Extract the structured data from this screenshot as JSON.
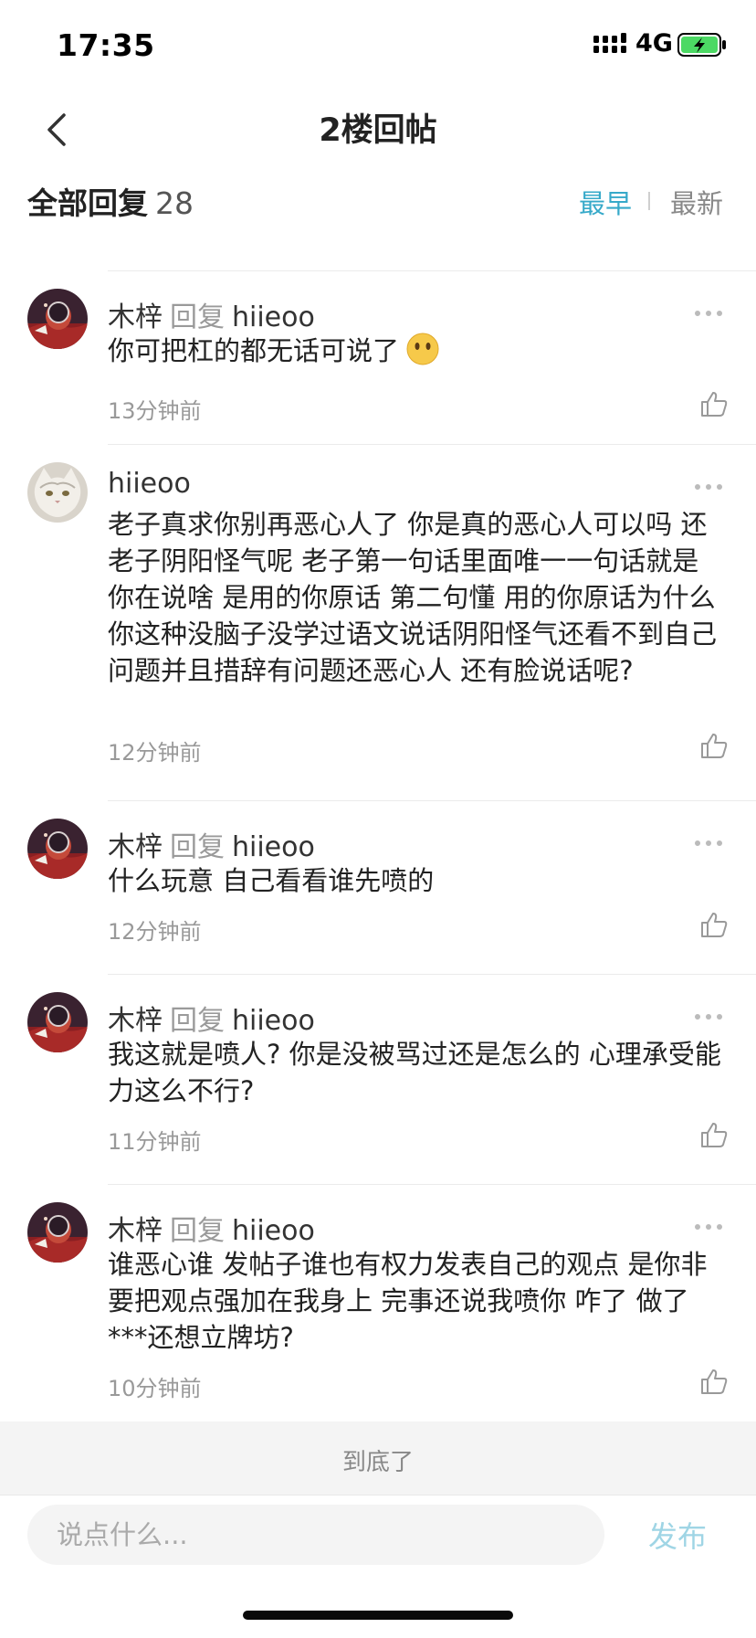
{
  "status_bar": {
    "time": "17:35",
    "network": "4G"
  },
  "nav": {
    "title": "2楼回帖"
  },
  "header": {
    "title": "全部回复",
    "count": "28",
    "sort_earliest": "最早",
    "sort_latest": "最新"
  },
  "reply_word": "回复",
  "replies": [
    {
      "author": "木梓",
      "target": "hiieoo",
      "text": "你可把杠的都无话可说了",
      "emoji": "no-mouth-emoji",
      "time": "13分钟前",
      "avatar": "astronaut-avatar"
    },
    {
      "author": "hiieoo",
      "target": "",
      "text": "老子真求你别再恶心人了 你是真的恶心人可以吗 还老子阴阳怪气呢 老子第一句话里面唯一一句话就是 你在说啥 是用的你原话 第二句懂 用的你原话为什么你这种没脑子没学过语文说话阴阳怪气还看不到自己问题并且措辞有问题还恶心人 还有脸说话呢?",
      "time": "12分钟前",
      "avatar": "cat-avatar"
    },
    {
      "author": "木梓",
      "target": "hiieoo",
      "text": "什么玩意 自己看看谁先喷的",
      "time": "12分钟前",
      "avatar": "astronaut-avatar"
    },
    {
      "author": "木梓",
      "target": "hiieoo",
      "text": "我这就是喷人? 你是没被骂过还是怎么的 心理承受能力这么不行?",
      "time": "11分钟前",
      "avatar": "astronaut-avatar"
    },
    {
      "author": "木梓",
      "target": "hiieoo",
      "text": "谁恶心谁 发帖子谁也有权力发表自己的观点 是你非要把观点强加在我身上 完事还说我喷你 咋了 做了***还想立牌坊?",
      "time": "10分钟前",
      "avatar": "astronaut-avatar"
    }
  ],
  "footer": {
    "end_text": "到底了"
  },
  "input": {
    "placeholder": "说点什么...",
    "publish_label": "发布"
  },
  "colors": {
    "accent": "#36a9c9",
    "publish": "#9fd5e5",
    "muted": "#999999"
  }
}
